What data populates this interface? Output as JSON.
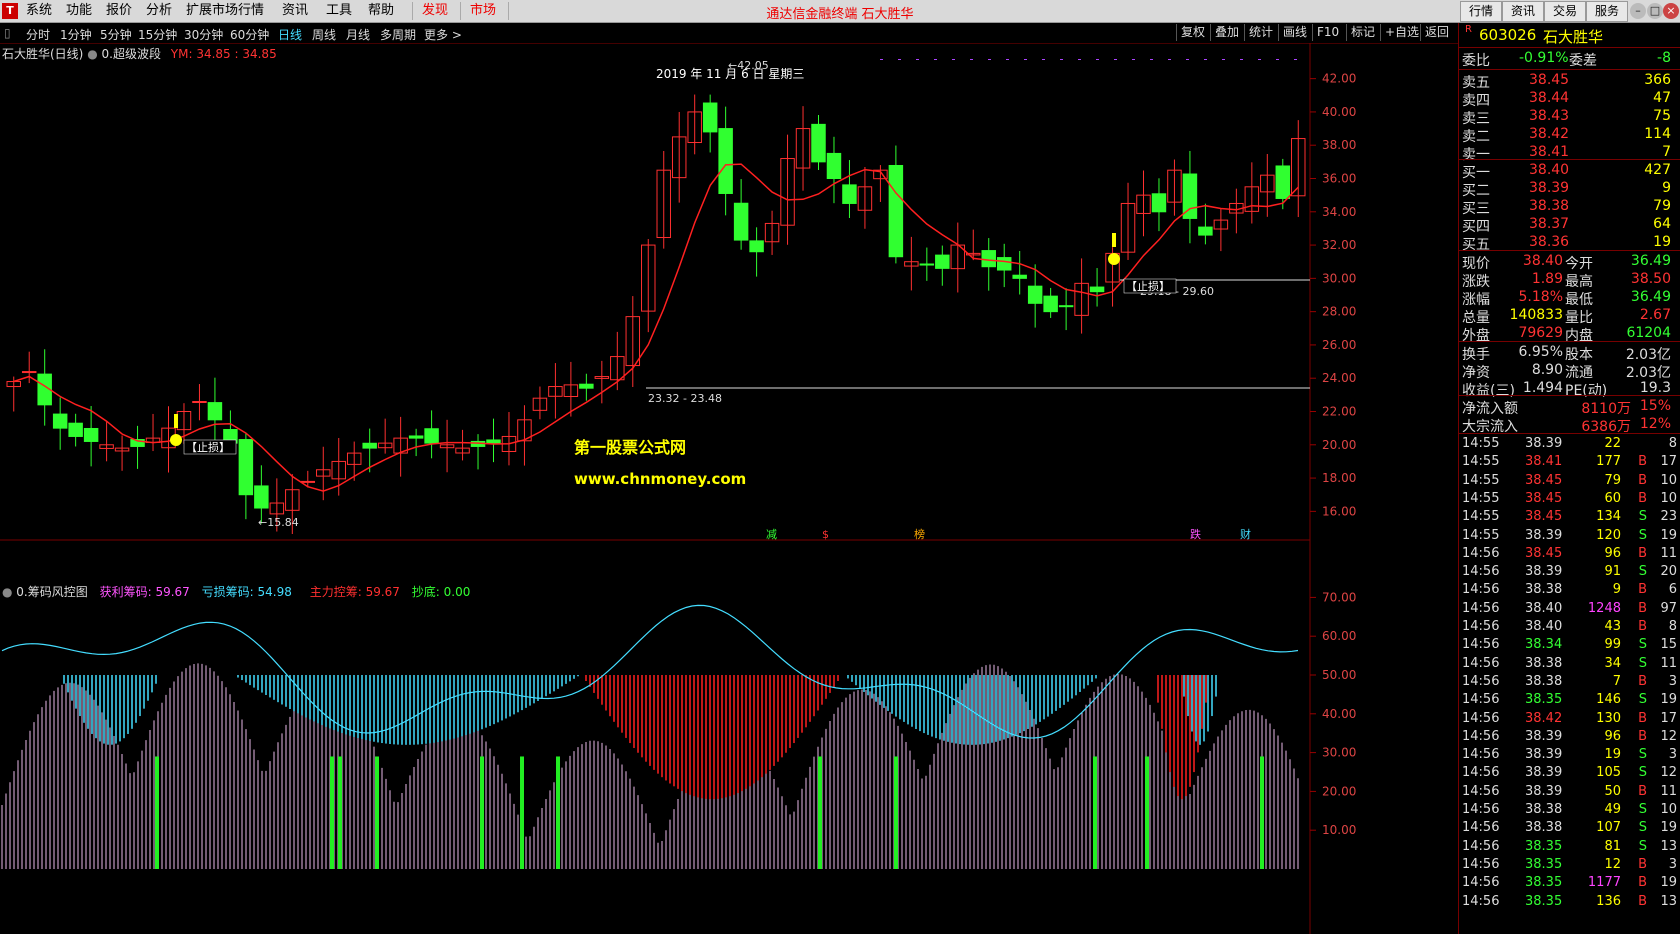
{
  "menubar": {
    "logo": "T",
    "items": [
      "系统",
      "功能",
      "报价",
      "分析",
      "扩展市场行情",
      "资讯",
      "工具",
      "帮助"
    ],
    "hot_items": [
      "发现",
      "市场"
    ],
    "center_title": "通达信金融终端  石大胜华",
    "right_buttons": [
      "行情",
      "资讯",
      "交易",
      "服务"
    ],
    "window_buttons": [
      "–",
      "□",
      "×"
    ]
  },
  "toolbar": {
    "left_icon": "▯",
    "periods": [
      "分时",
      "1分钟",
      "5分钟",
      "15分钟",
      "30分钟",
      "60分钟",
      "日线",
      "周线",
      "月线",
      "多周期",
      "更多 >"
    ],
    "active": "日线",
    "right": [
      "复权",
      "叠加",
      "统计",
      "画线",
      "F10",
      "标记",
      "+自选",
      "返回"
    ]
  },
  "chart": {
    "title": "石大胜华(日线)",
    "indicator": "0.超级波段",
    "ym_label": "YM: 34.85 : 34.85",
    "date_label": "2019 年 11 月 6 日 星期三",
    "high_label": "←42.05",
    "low_label": "←15.84",
    "zone1": "23.32 - 23.48",
    "zone2": "29.18 - 29.60",
    "stop_label": "【止损】",
    "watermark": "第一股票公式网",
    "watermark_url": "www.chnmoney.com",
    "markers": [
      "减",
      "$",
      "榜",
      "跌",
      "财"
    ],
    "y_ticks": [
      "42.00",
      "40.00",
      "38.00",
      "36.00",
      "34.00",
      "32.00",
      "30.00",
      "28.00",
      "26.00",
      "24.00",
      "22.00",
      "20.00",
      "18.00",
      "16.00"
    ],
    "colors": {
      "up": "#ff3030",
      "down": "#30ff30",
      "ma": "#ff2020"
    }
  },
  "indicator": {
    "name": "0.筹码风控图",
    "items": [
      {
        "label": "获利筹码:",
        "value": "59.67",
        "color": "#ff55ff"
      },
      {
        "label": "亏损筹码:",
        "value": "54.98",
        "color": "#44ddff"
      },
      {
        "label": "主力控筹:",
        "value": "59.67",
        "color": "#ff3030"
      },
      {
        "label": "抄底:",
        "value": "0.00",
        "color": "#33ff33"
      }
    ],
    "y_ticks": [
      "70.00",
      "60.00",
      "50.00",
      "40.00",
      "30.00",
      "20.00",
      "10.00"
    ]
  },
  "chart_data": {
    "type": "line",
    "title": "石大胜华(日线)",
    "xlabel": "",
    "ylabel": "",
    "price_ylim": [
      15,
      43
    ],
    "closes": [
      23.8,
      24.4,
      22.4,
      21.0,
      20.5,
      20.2,
      20.0,
      19.8,
      19.9,
      20.4,
      21.0,
      22.0,
      22.6,
      21.5,
      20.1,
      17.0,
      16.2,
      16.5,
      17.3,
      17.8,
      18.5,
      19.0,
      19.5,
      19.8,
      20.1,
      20.4,
      20.4,
      20.1,
      20.0,
      19.8,
      19.9,
      20.1,
      20.5,
      21.5,
      22.8,
      23.5,
      23.6,
      23.4,
      24.1,
      25.3,
      27.7,
      32.0,
      36.5,
      38.5,
      40.0,
      38.8,
      35.1,
      32.3,
      31.6,
      33.3,
      37.2,
      39.0,
      37.0,
      36.0,
      34.5,
      35.5,
      36.5,
      31.3,
      31.0,
      30.8,
      30.6,
      32.0,
      31.5,
      30.7,
      30.5,
      30.0,
      28.5,
      28.0,
      28.3,
      29.7,
      29.2,
      31.5,
      34.5,
      35.0,
      34.0,
      36.5,
      33.6,
      32.6,
      33.5,
      34.5,
      35.5,
      36.2,
      34.8,
      38.4
    ],
    "support_zones": [
      {
        "low": 23.32,
        "high": 23.48
      },
      {
        "low": 29.18,
        "high": 29.6
      }
    ],
    "high": 42.05,
    "low": 15.84,
    "chips": {
      "profit": 59.67,
      "loss": 54.98,
      "main": 59.67,
      "bottom": 0.0
    },
    "chip_ylim": [
      0,
      75
    ]
  },
  "quote": {
    "code": "603026",
    "name": "石大胜华",
    "code_prefix": "R",
    "weibi": {
      "label": "委比",
      "value": "-0.91%",
      "label2": "委差",
      "value2": "-8"
    },
    "asks": [
      {
        "label": "卖五",
        "price": "38.45",
        "vol": "366"
      },
      {
        "label": "卖四",
        "price": "38.44",
        "vol": "47"
      },
      {
        "label": "卖三",
        "price": "38.43",
        "vol": "75"
      },
      {
        "label": "卖二",
        "price": "38.42",
        "vol": "114"
      },
      {
        "label": "卖一",
        "price": "38.41",
        "vol": "7"
      }
    ],
    "bids": [
      {
        "label": "买一",
        "price": "38.40",
        "vol": "427"
      },
      {
        "label": "买二",
        "price": "38.39",
        "vol": "9"
      },
      {
        "label": "买三",
        "price": "38.38",
        "vol": "79"
      },
      {
        "label": "买四",
        "price": "38.37",
        "vol": "64"
      },
      {
        "label": "买五",
        "price": "38.36",
        "vol": "19"
      }
    ],
    "stats": [
      {
        "l1": "现价",
        "v1": "38.40",
        "c1": "up",
        "l2": "今开",
        "v2": "36.49",
        "c2": "dn"
      },
      {
        "l1": "涨跌",
        "v1": "1.89",
        "c1": "up",
        "l2": "最高",
        "v2": "38.50",
        "c2": "up"
      },
      {
        "l1": "涨幅",
        "v1": "5.18%",
        "c1": "up",
        "l2": "最低",
        "v2": "36.49",
        "c2": "dn"
      },
      {
        "l1": "总量",
        "v1": "140833",
        "c1": "yl",
        "l2": "量比",
        "v2": "2.67",
        "c2": "up"
      },
      {
        "l1": "外盘",
        "v1": "79629",
        "c1": "up",
        "l2": "内盘",
        "v2": "61204",
        "c2": "dn"
      }
    ],
    "stats2": [
      {
        "l1": "换手",
        "v1": "6.95%",
        "c1": "wh",
        "l2": "股本",
        "v2": "2.03亿",
        "c2": "wh"
      },
      {
        "l1": "净资",
        "v1": "8.90",
        "c1": "wh",
        "l2": "流通",
        "v2": "2.03亿",
        "c2": "wh"
      },
      {
        "l1": "收益(三)",
        "v1": "1.494",
        "c1": "wh",
        "l2": "PE(动)",
        "v2": "19.3",
        "c2": "wh"
      }
    ],
    "flows": [
      {
        "label": "净流入额",
        "value": "8110万",
        "pct": "15%"
      },
      {
        "label": "大宗流入",
        "value": "6386万",
        "pct": "12%"
      }
    ],
    "ticks": [
      [
        "14:55",
        "38.39",
        "22",
        "",
        "8",
        "wh",
        "yl"
      ],
      [
        "14:55",
        "38.41",
        "177",
        "B",
        "17",
        "up",
        "yl"
      ],
      [
        "14:55",
        "38.45",
        "79",
        "B",
        "10",
        "up",
        "yl"
      ],
      [
        "14:55",
        "38.45",
        "60",
        "B",
        "10",
        "up",
        "yl"
      ],
      [
        "14:55",
        "38.45",
        "134",
        "S",
        "23",
        "up",
        "yl"
      ],
      [
        "14:55",
        "38.39",
        "120",
        "S",
        "19",
        "wh",
        "yl"
      ],
      [
        "14:56",
        "38.45",
        "96",
        "B",
        "11",
        "up",
        "yl"
      ],
      [
        "14:56",
        "38.39",
        "91",
        "S",
        "20",
        "wh",
        "yl"
      ],
      [
        "14:56",
        "38.38",
        "9",
        "B",
        "6",
        "wh",
        "yl"
      ],
      [
        "14:56",
        "38.40",
        "1248",
        "B",
        "97",
        "wh",
        "mg"
      ],
      [
        "14:56",
        "38.40",
        "43",
        "B",
        "8",
        "wh",
        "yl"
      ],
      [
        "14:56",
        "38.34",
        "99",
        "S",
        "15",
        "dn",
        "yl"
      ],
      [
        "14:56",
        "38.38",
        "34",
        "S",
        "11",
        "wh",
        "yl"
      ],
      [
        "14:56",
        "38.38",
        "7",
        "B",
        "3",
        "wh",
        "yl"
      ],
      [
        "14:56",
        "38.35",
        "146",
        "S",
        "19",
        "dn",
        "yl"
      ],
      [
        "14:56",
        "38.42",
        "130",
        "B",
        "17",
        "up",
        "yl"
      ],
      [
        "14:56",
        "38.39",
        "96",
        "B",
        "12",
        "wh",
        "yl"
      ],
      [
        "14:56",
        "38.39",
        "19",
        "S",
        "3",
        "wh",
        "yl"
      ],
      [
        "14:56",
        "38.39",
        "105",
        "S",
        "12",
        "wh",
        "yl"
      ],
      [
        "14:56",
        "38.39",
        "50",
        "B",
        "11",
        "wh",
        "yl"
      ],
      [
        "14:56",
        "38.38",
        "49",
        "S",
        "10",
        "wh",
        "yl"
      ],
      [
        "14:56",
        "38.38",
        "107",
        "S",
        "19",
        "wh",
        "yl"
      ],
      [
        "14:56",
        "38.35",
        "81",
        "S",
        "13",
        "dn",
        "yl"
      ],
      [
        "14:56",
        "38.35",
        "12",
        "B",
        "3",
        "dn",
        "yl"
      ],
      [
        "14:56",
        "38.35",
        "1177",
        "B",
        "19",
        "dn",
        "mg"
      ],
      [
        "14:56",
        "38.35",
        "136",
        "B",
        "13",
        "dn",
        "yl"
      ]
    ]
  }
}
